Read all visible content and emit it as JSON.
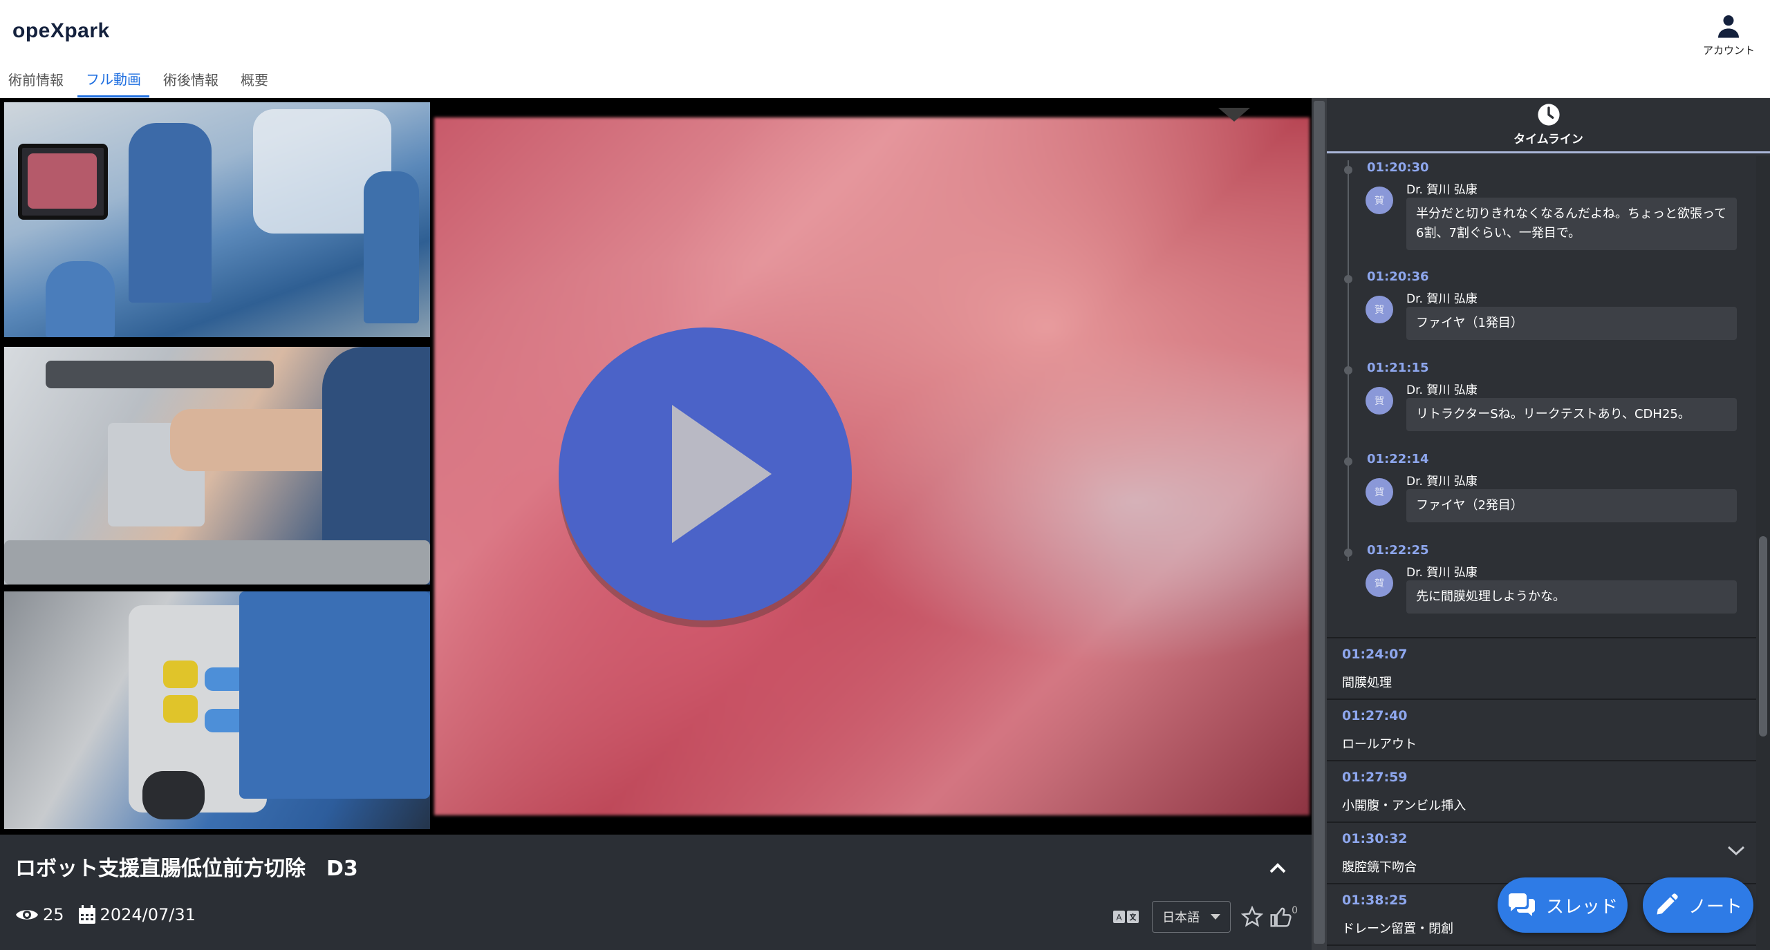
{
  "app": {
    "logo": "opeXpark",
    "account_label": "アカウント"
  },
  "tabs": [
    {
      "label": "術前情報",
      "active": false
    },
    {
      "label": "フル動画",
      "active": true
    },
    {
      "label": "術後情報",
      "active": false
    },
    {
      "label": "概要",
      "active": false
    }
  ],
  "video": {
    "title": "ロボット支援直腸低位前方切除　D3",
    "views": "25",
    "date": "2024/07/31",
    "language": "日本語",
    "like_count": "0"
  },
  "sidebar": {
    "header_label": "タイムライン",
    "comments": [
      {
        "time": "01:20:30",
        "avatar": "賀",
        "author": "Dr. 賀川 弘康",
        "text": "半分だと切りきれなくなるんだよね。ちょっと欲張って6割、7割ぐらい、一発目で。"
      },
      {
        "time": "01:20:36",
        "avatar": "賀",
        "author": "Dr. 賀川 弘康",
        "text": "ファイヤ（1発目）"
      },
      {
        "time": "01:21:15",
        "avatar": "賀",
        "author": "Dr. 賀川 弘康",
        "text": "リトラクターSね。リークテストあり、CDH25。"
      },
      {
        "time": "01:22:14",
        "avatar": "賀",
        "author": "Dr. 賀川 弘康",
        "text": "ファイヤ（2発目）"
      },
      {
        "time": "01:22:25",
        "avatar": "賀",
        "author": "Dr. 賀川 弘康",
        "text": "先に間膜処理しようかな。"
      }
    ],
    "chapters": [
      {
        "time": "01:24:07",
        "title": "間膜処理"
      },
      {
        "time": "01:27:40",
        "title": "ロールアウト"
      },
      {
        "time": "01:27:59",
        "title": "小開腹・アンビル挿入"
      },
      {
        "time": "01:30:32",
        "title": "腹腔鏡下吻合"
      },
      {
        "time": "01:38:25",
        "title": "ドレーン留置・閉創"
      }
    ]
  },
  "buttons": {
    "thread": "スレッド",
    "note": "ノート"
  }
}
